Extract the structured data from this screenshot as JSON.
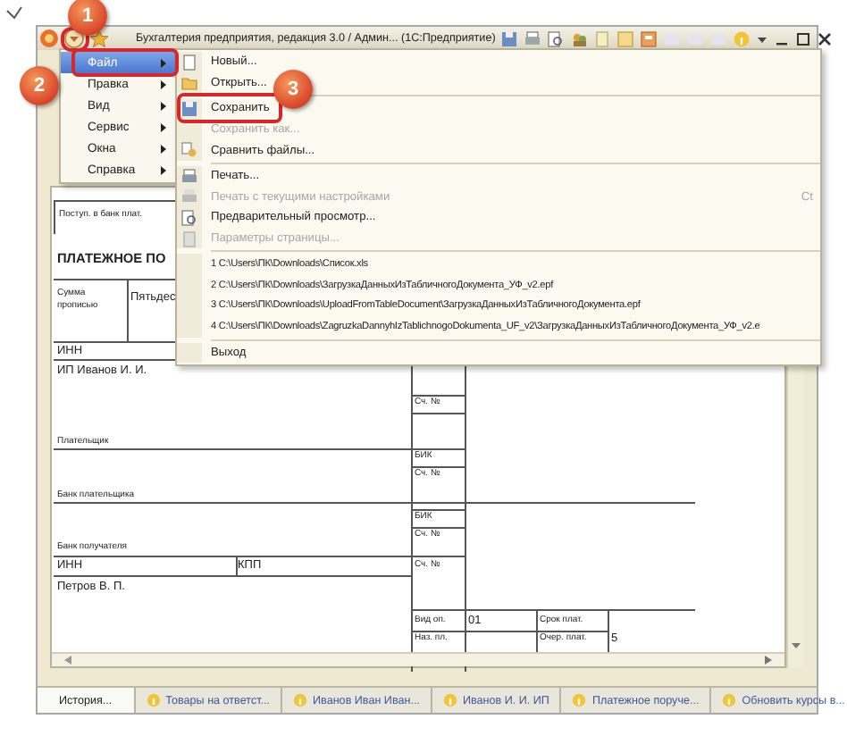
{
  "window": {
    "title": "Бухгалтерия предприятия, редакция 3.0 / Админ... (1С:Предприятие)"
  },
  "main_menu": [
    {
      "label": "Файл",
      "selected": true
    },
    {
      "label": "Правка",
      "selected": false
    },
    {
      "label": "Вид",
      "selected": false
    },
    {
      "label": "Сервис",
      "selected": false
    },
    {
      "label": "Окна",
      "selected": false
    },
    {
      "label": "Справка",
      "selected": false
    }
  ],
  "file_menu": [
    {
      "kind": "item",
      "label": "Новый...",
      "disabled": false
    },
    {
      "kind": "item",
      "label": "Открыть...",
      "disabled": false
    },
    {
      "kind": "separator"
    },
    {
      "kind": "item",
      "label": "Сохранить",
      "disabled": false
    },
    {
      "kind": "item",
      "label": "Сохранить как...",
      "disabled": true
    },
    {
      "kind": "item",
      "label": "Сравнить файлы...",
      "disabled": false
    },
    {
      "kind": "separator"
    },
    {
      "kind": "item",
      "label": "Печать...",
      "disabled": false
    },
    {
      "kind": "item",
      "label": "Печать с текущими настройками",
      "disabled": true,
      "shortcut": "Ct"
    },
    {
      "kind": "item",
      "label": "Предварительный просмотр...",
      "disabled": false
    },
    {
      "kind": "item",
      "label": "Параметры страницы...",
      "disabled": true
    },
    {
      "kind": "separator"
    },
    {
      "kind": "recent",
      "label": "1 C:\\Users\\ПК\\Downloads\\Список.xls",
      "disabled": false
    },
    {
      "kind": "recent",
      "label": "2 C:\\Users\\ПК\\Downloads\\ЗагрузкаДанныхИзТабличногоДокумента_УФ_v2.epf",
      "disabled": false
    },
    {
      "kind": "recent",
      "label": "3 C:\\Users\\ПК\\Downloads\\UploadFromTableDocument\\ЗагрузкаДанныхИзТабличногоДокумента.epf",
      "disabled": false
    },
    {
      "kind": "recent",
      "label": "4 C:\\Users\\ПК\\Downloads\\ZagruzkaDannyhIzTablichnogoDokumenta_UF_v2\\ЗагрузкаДанныхИзТабличногоДокумента_УФ_v2.e",
      "disabled": false
    },
    {
      "kind": "separator"
    },
    {
      "kind": "item",
      "label": "Выход",
      "disabled": false
    }
  ],
  "document": {
    "cells": [
      {
        "kind": "stamp",
        "text": "Поступ. в банк плат."
      },
      {
        "kind": "heading",
        "text": "ПЛАТЕЖНОЕ ПО"
      },
      {
        "kind": "caption",
        "text": "Сумма прописью"
      },
      {
        "kind": "value",
        "text": "Пятьдес"
      },
      {
        "kind": "value",
        "text": "ИНН"
      },
      {
        "kind": "value",
        "text": "ИП Иванов И. И."
      },
      {
        "kind": "caption",
        "text": "Плательщик"
      },
      {
        "kind": "caption",
        "text": "Сч. №"
      },
      {
        "kind": "caption",
        "text": "БИК"
      },
      {
        "kind": "caption",
        "text": "Сч. №"
      },
      {
        "kind": "caption",
        "text": "Банк плательщика"
      },
      {
        "kind": "caption",
        "text": "БИК"
      },
      {
        "kind": "caption",
        "text": "Сч. №"
      },
      {
        "kind": "caption",
        "text": "Банк получателя"
      },
      {
        "kind": "value",
        "text": "ИНН"
      },
      {
        "kind": "value",
        "text": "КПП"
      },
      {
        "kind": "caption",
        "text": "Сч. №"
      },
      {
        "kind": "value",
        "text": "Петров В. П."
      },
      {
        "kind": "caption",
        "text": "Вид оп."
      },
      {
        "kind": "value",
        "text": "01"
      },
      {
        "kind": "caption",
        "text": "Срок плат."
      },
      {
        "kind": "caption",
        "text": "Наз. пл."
      },
      {
        "kind": "caption",
        "text": "Очер. плат."
      },
      {
        "kind": "value",
        "text": "5"
      }
    ]
  },
  "taskbar": [
    {
      "label": "История...",
      "selected": true
    },
    {
      "label": "Товары на ответст...",
      "selected": false
    },
    {
      "label": "Иванов Иван Иван...",
      "selected": false
    },
    {
      "label": "Иванов И. И. ИП",
      "selected": false
    },
    {
      "label": "Платежное поруче...",
      "selected": false
    },
    {
      "label": "Обновить курсы в...",
      "selected": false
    }
  ],
  "annotations": [
    {
      "number": "1"
    },
    {
      "number": "2"
    },
    {
      "number": "3"
    }
  ]
}
